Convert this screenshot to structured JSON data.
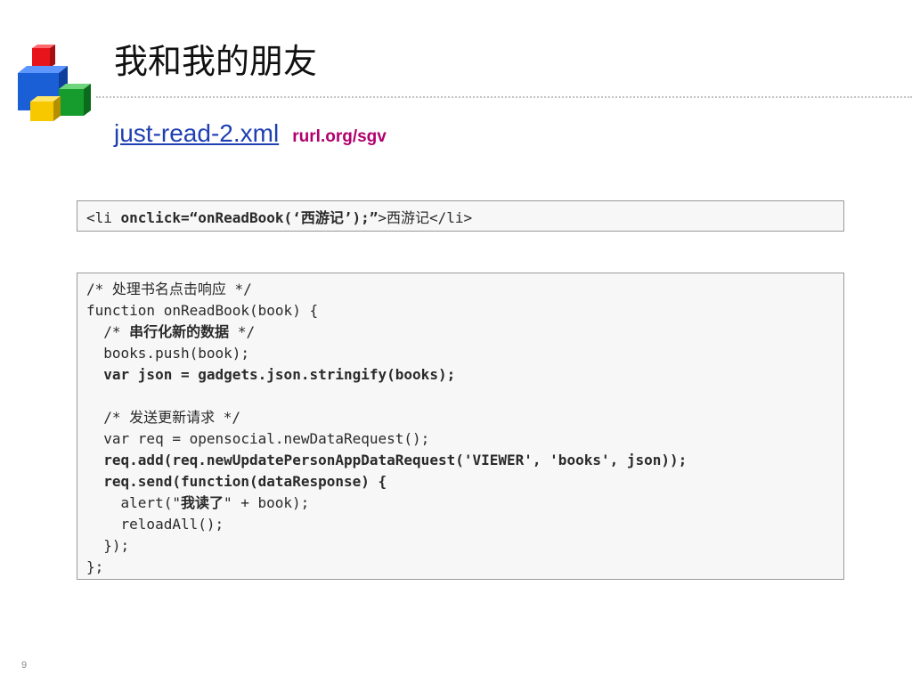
{
  "slide": {
    "title": "我和我的朋友",
    "file_link": "just-read-2.xml",
    "short_url": "rurl.org/sgv",
    "page_number": "9"
  },
  "code_snippet_1": {
    "lines": [
      {
        "segments": [
          {
            "text": "<li ",
            "bold": false
          },
          {
            "text": "onclick=“onReadBook(‘西游记’);”",
            "bold": true
          },
          {
            "text": ">西游记</li>",
            "bold": false
          }
        ]
      }
    ]
  },
  "code_snippet_2": {
    "lines": [
      {
        "segments": [
          {
            "text": "/* 处理书名点击响应 */",
            "bold": false
          }
        ]
      },
      {
        "segments": [
          {
            "text": "function onReadBook(book) {",
            "bold": false
          }
        ]
      },
      {
        "segments": [
          {
            "text": "  /* ",
            "bold": false
          },
          {
            "text": "串行化新的数据",
            "bold": true
          },
          {
            "text": " */",
            "bold": false
          }
        ]
      },
      {
        "segments": [
          {
            "text": "  books.push(book);",
            "bold": false
          }
        ]
      },
      {
        "segments": [
          {
            "text": "  var json = gadgets.json.stringify(books);",
            "bold": true
          }
        ]
      },
      {
        "segments": []
      },
      {
        "segments": [
          {
            "text": "  /* 发送更新请求 */",
            "bold": false
          }
        ]
      },
      {
        "segments": [
          {
            "text": "  var req = opensocial.newDataRequest();",
            "bold": false
          }
        ]
      },
      {
        "segments": [
          {
            "text": "  req.add(req.newUpdatePersonAppDataRequest('VIEWER', 'books', json));",
            "bold": true
          }
        ]
      },
      {
        "segments": [
          {
            "text": "  req.send(function(dataResponse) {",
            "bold": true
          }
        ]
      },
      {
        "segments": [
          {
            "text": "    alert(\"",
            "bold": false
          },
          {
            "text": "我读了",
            "bold": true
          },
          {
            "text": "\" + book);",
            "bold": false
          }
        ]
      },
      {
        "segments": [
          {
            "text": "    reloadAll();",
            "bold": false
          }
        ]
      },
      {
        "segments": [
          {
            "text": "  });",
            "bold": false
          }
        ]
      },
      {
        "segments": [
          {
            "text": "};",
            "bold": false
          }
        ]
      }
    ]
  },
  "colors": {
    "link": "#1f3fb3",
    "short_url": "#b0006e",
    "code_bg": "#f7f7f7",
    "logo_red": "#e8141c",
    "logo_blue": "#1a5fd6",
    "logo_green": "#169c2c",
    "logo_yellow": "#f7c800"
  },
  "icons": {
    "logo": "stacked-cubes-icon"
  }
}
